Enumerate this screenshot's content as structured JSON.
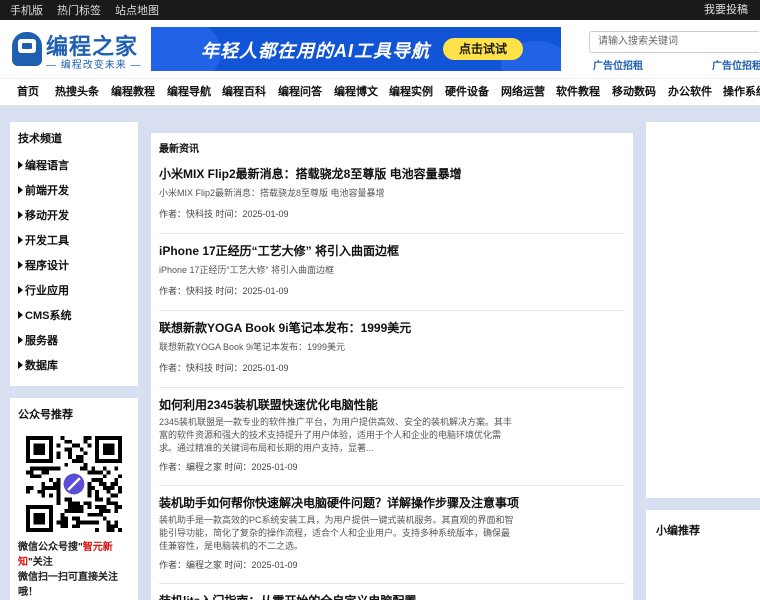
{
  "topbar": {
    "links": [
      "手机版",
      "热门标签",
      "站点地图"
    ],
    "right": "我要投稿"
  },
  "header": {
    "logo_title": "编程之家",
    "logo_sub": "— 编程改变未来 —",
    "banner_text": "年轻人都在用的AI工具导航",
    "banner_button": "点击试试",
    "search_placeholder": "请输入搜索关键词",
    "ad_left": "广告位招租",
    "ad_right": "广告位招租"
  },
  "nav": [
    "首页",
    "热搜头条",
    "编程教程",
    "编程导航",
    "编程百科",
    "编程问答",
    "编程博文",
    "编程实例",
    "硬件设备",
    "网络运营",
    "软件教程",
    "移动数码",
    "办公软件",
    "操作系统"
  ],
  "channels": {
    "title": "技术频道",
    "items": [
      "编程语言",
      "前端开发",
      "移动开发",
      "开发工具",
      "程序设计",
      "行业应用",
      "CMS系统",
      "服务器",
      "数据库"
    ]
  },
  "wechat": {
    "title": "公众号推荐",
    "text_before": "微信公众号搜\"",
    "highlight": "智元新知",
    "text_after": "\"关注",
    "text_line2": "微信扫一扫可直接关注哦！"
  },
  "news": {
    "title": "最新资讯",
    "articles": [
      {
        "title": "小米MIX Flip2最新消息：搭载骁龙8至尊版 电池容量暴增",
        "summary": "小米MIX Flip2最新消息：搭载骁龙8至尊版 电池容量暴增",
        "meta": "作者：快科技 时间：2025-01-09"
      },
      {
        "title": "iPhone 17正经历“工艺大修” 将引入曲面边框",
        "summary": "iPhone 17正经历“工艺大修” 将引入曲面边框",
        "meta": "作者：快科技 时间：2025-01-09"
      },
      {
        "title": "联想新款YOGA Book 9i笔记本发布：1999美元",
        "summary": "联想新款YOGA Book 9i笔记本发布：1999美元",
        "meta": "作者：快科技 时间：2025-01-09"
      },
      {
        "title": "如何利用2345装机联盟快速优化电脑性能",
        "summary": "2345装机联盟是一款专业的软件推广平台，为用户提供高效、安全的装机解决方案。其丰富的软件资源和强大的技术支持提升了用户体验，适用于个人和企业的电脑环境优化需求。通过精准的关键词布局和长期的用户支持，显著...",
        "meta": "作者：编程之家 时间：2025-01-09"
      },
      {
        "title": "装机助手如何帮你快速解决电脑硬件问题？详解操作步骤及注意事项",
        "summary": "装机助手是一款高效的PC系统安装工具，为用户提供一键式装机服务。其直观的界面和智能引导功能，简化了复杂的操作流程，适合个人和企业用户。支持多种系统版本，确保最佳兼容性，是电脑装机的不二之选。",
        "meta": "作者：编程之家 时间：2025-01-09"
      },
      {
        "title": "装机lite入门指南：从零开始的全自定义电脑配置",
        "summary": "",
        "meta": ""
      }
    ]
  },
  "right": {
    "editor_title": "小编推荐"
  }
}
